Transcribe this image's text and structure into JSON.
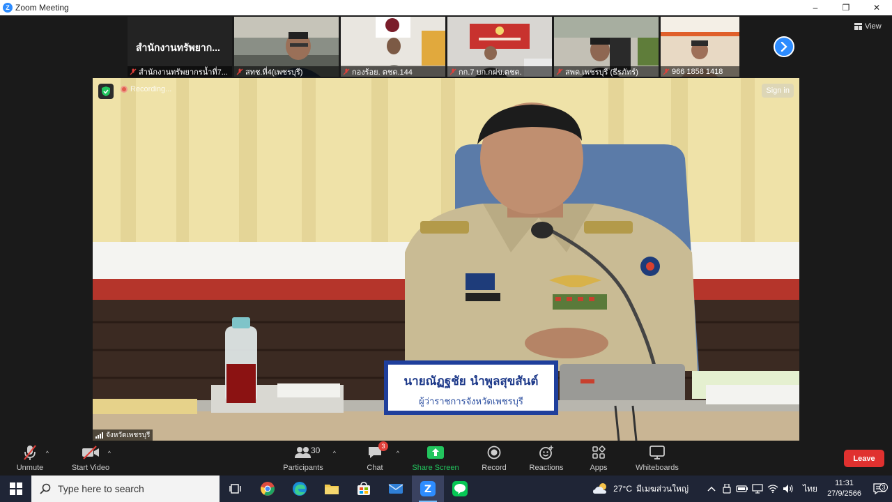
{
  "window": {
    "title": "Zoom Meeting",
    "logo_letter": "Z",
    "controls": [
      "–",
      "❐",
      "✕"
    ]
  },
  "thumbnails": [
    {
      "name": "สำนักงานทรัพยากรน้ำที่7...",
      "big_name": "สำนักงานทรัพยาก...",
      "muted": true,
      "has_video": false
    },
    {
      "name": "สทช.ที่4(เพชรบุรี)",
      "muted": true,
      "has_video": true
    },
    {
      "name": "กองร้อย. ตชด.144",
      "muted": true,
      "has_video": true
    },
    {
      "name": "กก.7 บก.กฝข.ตชด.",
      "muted": true,
      "has_video": true
    },
    {
      "name": "สพด.เพชรบุรี (ธีรภัทร์)",
      "muted": true,
      "has_video": true
    },
    {
      "name": "966 1858 1418",
      "muted": true,
      "has_video": true
    }
  ],
  "view_button": {
    "label": "View"
  },
  "main_video": {
    "speaker_label": "จังหวัดเพชรบุรี",
    "recording_label": "Recording...",
    "sign_in_label": "Sign in",
    "nameplate_line1": "นายณัฏฐชัย  นำพูลสุขสันต์",
    "nameplate_line2": "ผู้ว่าราชการจังหวัดเพชรบุรี"
  },
  "toolbar": {
    "unmute": "Unmute",
    "start_video": "Start Video",
    "participants": "Participants",
    "participants_count": "30",
    "chat": "Chat",
    "chat_badge": "3",
    "share_screen": "Share Screen",
    "record": "Record",
    "reactions": "Reactions",
    "apps": "Apps",
    "whiteboards": "Whiteboards",
    "leave": "Leave"
  },
  "taskbar": {
    "search_placeholder": "Type here to search",
    "weather_temp": "27°C",
    "weather_desc": "มีเมฆส่วนใหญ่",
    "language": "ไทย",
    "time": "11:31",
    "date": "27/9/2566",
    "notification_count": "3"
  },
  "colors": {
    "zoom_blue": "#2d8cff",
    "leave_red": "#e0312f",
    "share_green": "#22c55e",
    "taskbar_bg": "#1f2536"
  }
}
